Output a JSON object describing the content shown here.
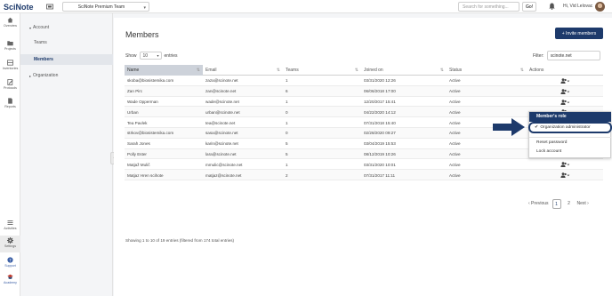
{
  "topbar": {
    "logo_main": "SciNote",
    "team": "SciNote Premium Team",
    "search_placeholder": "Search for something...",
    "go_label": "Go!",
    "greeting": "Hi, Vid Lelovac"
  },
  "rail": [
    {
      "label": "Overview",
      "icon": "home-icon"
    },
    {
      "label": "Projects",
      "icon": "folder-icon"
    },
    {
      "label": "Inventories",
      "icon": "inventory-icon"
    },
    {
      "label": "Protocols",
      "icon": "protocol-icon"
    },
    {
      "label": "Reports",
      "icon": "report-icon"
    },
    {
      "label": "Activities",
      "icon": "activity-icon"
    },
    {
      "label": "Settings",
      "icon": "gear-icon"
    },
    {
      "label": "Support",
      "icon": "help-icon"
    },
    {
      "label": "Academy",
      "icon": "academy-icon"
    }
  ],
  "submenu": {
    "account": "Account",
    "teams": "Teams",
    "members": "Members",
    "organization": "Organization"
  },
  "page": {
    "title": "Members",
    "invite_label": "+ Invite members",
    "show_label": "Show",
    "show_value": "10",
    "entries_label": "entries",
    "filter_label": "Filter:",
    "filter_value": "scinote.net"
  },
  "table": {
    "headers": [
      "Name",
      "Email",
      "Teams",
      "Joined on",
      "Status",
      "Actions"
    ],
    "rows": [
      {
        "name": "skoba@biosistemika.com",
        "email": "zaza@scinote.net",
        "teams": "1",
        "joined": "03/31/2020 12:26",
        "status": "Active"
      },
      {
        "name": "Zan Pirc",
        "email": "zan@scinote.net",
        "teams": "6",
        "joined": "06/06/2018 17:00",
        "status": "Active"
      },
      {
        "name": "Wade Opperman",
        "email": "wade@scinote.net",
        "teams": "1",
        "joined": "12/20/2017 15:41",
        "status": "Active"
      },
      {
        "name": "Urban",
        "email": "urban@scinote.net",
        "teams": "0",
        "joined": "04/22/2020 14:12",
        "status": "Active"
      },
      {
        "name": "Tea Pavlek",
        "email": "tea@scinote.net",
        "teams": "1",
        "joined": "07/31/2018 15:40",
        "status": "Active"
      },
      {
        "name": "strkov@biosistemika.com",
        "email": "sasa@scinote.net",
        "teams": "0",
        "joined": "02/28/2020 09:27",
        "status": "Active"
      },
      {
        "name": "Sarah Jones",
        "email": "karin@scinote.net",
        "teams": "5",
        "joined": "03/04/2019 15:53",
        "status": "Active"
      },
      {
        "name": "Polly Ester",
        "email": "lara@scinote.net",
        "teams": "5",
        "joined": "08/12/2019 10:26",
        "status": "Active"
      },
      {
        "name": "Matjaž Mulič",
        "email": "mmulic@scinote.net",
        "teams": "1",
        "joined": "03/31/2020 10:01",
        "status": "Active"
      },
      {
        "name": "Matjaz Hren scihote",
        "email": "matjaz@scinote.net",
        "teams": "2",
        "joined": "07/31/2017 11:11",
        "status": "Active"
      }
    ]
  },
  "footer": {
    "info": "Showing 1 to 10 of 19 entries (filtered from 174 total entries)",
    "previous": "‹ Previous",
    "page1": "1",
    "page2": "2",
    "next": "Next ›"
  },
  "role_menu": {
    "header": "Member's role",
    "option": "Organization administrator",
    "reset": "Reset password",
    "lock": "Lock account"
  },
  "colors": {
    "brand": "#1d3a6b",
    "sorted_header": "#cdd2da"
  }
}
